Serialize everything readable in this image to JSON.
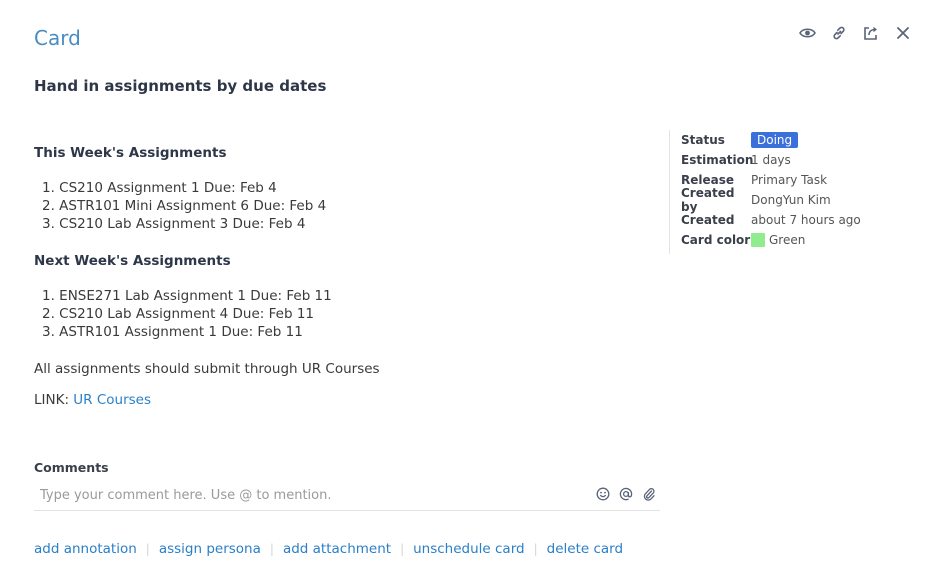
{
  "header": {
    "title": "Card",
    "icons": [
      "eye-icon",
      "link-icon",
      "share-icon",
      "close-icon"
    ]
  },
  "card": {
    "heading": "Hand in assignments by due dates"
  },
  "description": {
    "this_week": {
      "heading": "This Week's Assignments",
      "items": [
        "1. CS210 Assignment 1 Due: Feb 4",
        "2. ASTR101 Mini Assignment 6 Due: Feb 4",
        "3. CS210 Lab Assignment 3 Due: Feb 4"
      ]
    },
    "next_week": {
      "heading": "Next Week's Assignments",
      "items": [
        "1. ENSE271 Lab Assignment 1 Due: Feb 11",
        "2. CS210 Lab Assignment 4 Due: Feb 11",
        "3. ASTR101 Assignment 1 Due: Feb 11"
      ]
    },
    "note": "All assignments should submit through UR Courses",
    "link_prefix": "LINK: ",
    "link_text": "UR Courses"
  },
  "meta": {
    "status_label": "Status",
    "status_value": "Doing",
    "status_color": "#3b6fd9",
    "estimation_label": "Estimation",
    "estimation_value": "1 days",
    "release_label": "Release",
    "release_value": "Primary Task",
    "created_by_label": "Created by",
    "created_by_value": "DongYun Kim",
    "created_label": "Created",
    "created_value": "about 7 hours ago",
    "card_color_label": "Card color",
    "card_color_value": "Green",
    "card_color_hex": "#8fec8f"
  },
  "comments": {
    "label": "Comments",
    "placeholder": "Type your comment here. Use @ to mention.",
    "tools": [
      "smiley-icon",
      "at-sign-icon",
      "paperclip-icon"
    ]
  },
  "footer": {
    "add_annotation": "add annotation",
    "assign_persona": "assign persona",
    "add_attachment": "add attachment",
    "unschedule_card": "unschedule card",
    "delete_card": "delete card"
  },
  "colors": {
    "accent": "#2a7fc8",
    "title": "#4a8bc2",
    "icon": "#5a6478"
  }
}
